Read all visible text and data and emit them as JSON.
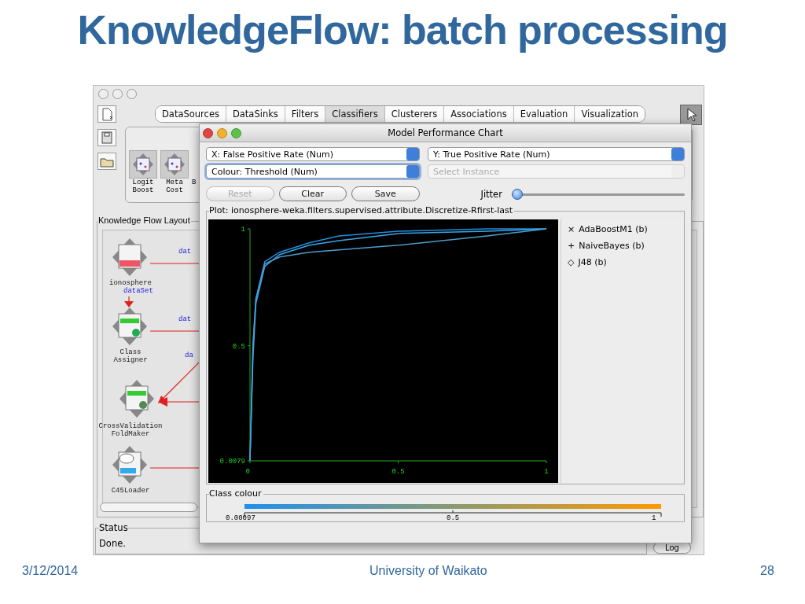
{
  "slide": {
    "title": "KnowledgeFlow: batch processing",
    "footer": {
      "date": "3/12/2014",
      "organization": "University of Waikato",
      "page_number": "28"
    }
  },
  "app_window": {
    "tabs": [
      {
        "label": "DataSources",
        "selected": false
      },
      {
        "label": "DataSinks",
        "selected": false
      },
      {
        "label": "Filters",
        "selected": false
      },
      {
        "label": "Classifiers",
        "selected": true
      },
      {
        "label": "Clusterers",
        "selected": false
      },
      {
        "label": "Associations",
        "selected": false
      },
      {
        "label": "Evaluation",
        "selected": false
      },
      {
        "label": "Visualization",
        "selected": false
      }
    ],
    "palette": [
      {
        "label": "Logit\nBoost"
      },
      {
        "label": "Meta\nCost"
      },
      {
        "label": "B"
      }
    ],
    "layout_panel": {
      "title": "Knowledge Flow Layout",
      "nodes": [
        {
          "label": "ionosphere"
        },
        {
          "label": "Class\nAssigner"
        },
        {
          "label": "CrossValidation\nFoldMaker"
        },
        {
          "label": "C45Loader"
        }
      ],
      "connection_labels": [
        "dat",
        "dataSet",
        "dat",
        "da"
      ]
    },
    "status": {
      "title": "Status",
      "text": "Done."
    },
    "log_button": "Log"
  },
  "chart_window": {
    "title": "Model Performance Chart",
    "x_select": "X: False Positive Rate (Num)",
    "y_select": "Y: True Positive Rate (Num)",
    "colour_select": "Colour: Threshold (Num)",
    "instance_select": {
      "placeholder": "Select Instance",
      "disabled": true
    },
    "buttons": [
      {
        "label": "Reset",
        "disabled": true
      },
      {
        "label": "Clear",
        "disabled": false
      },
      {
        "label": "Save",
        "disabled": false
      }
    ],
    "jitter": {
      "label": "Jitter",
      "level": 0
    },
    "plot": {
      "title": "Plot: ionosphere-weka.filters.supervised.attribute.Discretize-Rfirst-last",
      "chart_data": {
        "type": "line",
        "x": [
          0,
          0.01,
          0.02,
          0.05,
          0.1,
          0.2,
          0.3,
          0.5,
          0.8,
          1
        ],
        "xlim": [
          0,
          1
        ],
        "ylim": [
          0.0079,
          1
        ],
        "xticks": [
          0,
          0.5,
          1
        ],
        "yticks": [
          0.0079,
          0.5,
          1
        ],
        "series": [
          {
            "name": "AdaBoostM1 (b)",
            "color": "#1e8fe0",
            "values": [
              0.01,
              0.5,
              0.7,
              0.86,
              0.9,
              0.94,
              0.97,
              0.99,
              1,
              1
            ]
          },
          {
            "name": "NaiveBayes (b)",
            "color": "#3aa6e8",
            "values": [
              0.01,
              0.45,
              0.68,
              0.84,
              0.89,
              0.93,
              0.95,
              0.98,
              0.99,
              1
            ]
          },
          {
            "name": "J48 (b)",
            "color": "#4b9ccc",
            "values": [
              0.01,
              0.5,
              0.7,
              0.85,
              0.88,
              0.9,
              0.91,
              0.93,
              0.97,
              1
            ]
          }
        ]
      }
    },
    "legend_markers": [
      "×",
      "+",
      "◇"
    ],
    "class_colour": {
      "title": "Class colour",
      "ticks": [
        "0.00097",
        "0.5",
        "1"
      ]
    }
  }
}
